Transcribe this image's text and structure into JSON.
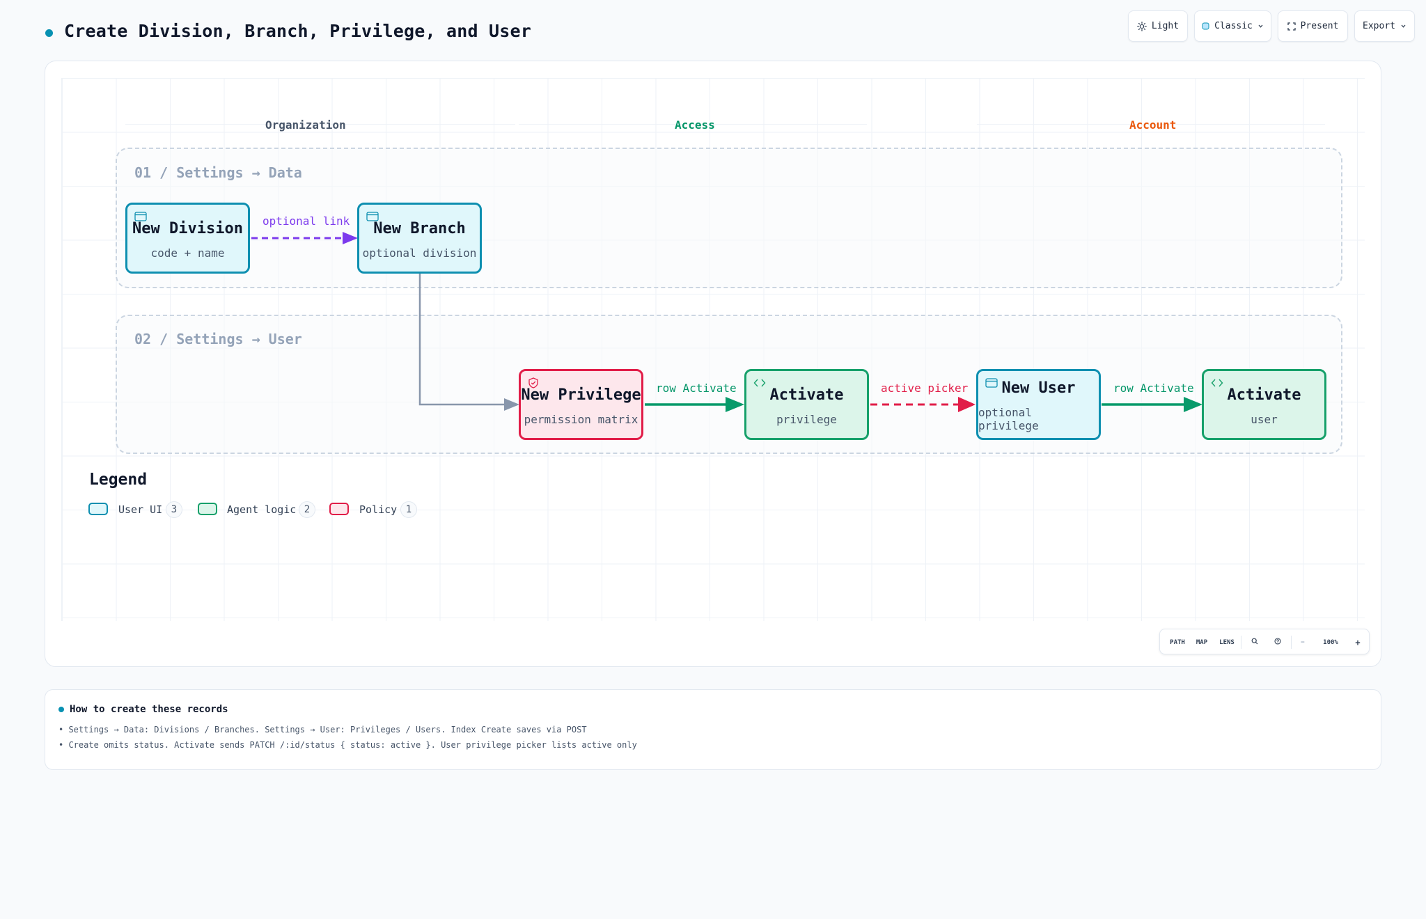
{
  "header": {
    "title": "Create Division, Branch, Privilege, and User",
    "buttons": {
      "theme": "Light",
      "style": "Classic",
      "present": "Present",
      "export": "Export"
    }
  },
  "colors": {
    "accent": "#0891b2",
    "ui": "#0e8fb0",
    "logic": "#16a06a",
    "policy": "#e11d48",
    "optional": "#7c3aed"
  },
  "lanes": [
    {
      "label": "Organization",
      "color": "#475569"
    },
    {
      "label": "Access",
      "color": "#059669"
    },
    {
      "label": "Account",
      "color": "#ea580c"
    }
  ],
  "groups": [
    {
      "label": "01 / Settings → Data"
    },
    {
      "label": "02 / Settings → User"
    }
  ],
  "nodes": {
    "new_division": {
      "title": "New Division",
      "sub": "code + name",
      "kind": "ui",
      "icon": "window-icon"
    },
    "new_branch": {
      "title": "New Branch",
      "sub": "optional division",
      "kind": "ui",
      "icon": "window-icon"
    },
    "new_privilege": {
      "title": "New Privilege",
      "sub": "permission matrix",
      "kind": "policy",
      "icon": "shield-icon"
    },
    "activate_privilege": {
      "title": "Activate",
      "sub": "privilege",
      "kind": "logic",
      "icon": "code-icon"
    },
    "new_user": {
      "title": "New User",
      "sub": "optional privilege",
      "kind": "ui",
      "icon": "window-icon"
    },
    "activate_user": {
      "title": "Activate",
      "sub": "user",
      "kind": "logic",
      "icon": "code-icon"
    }
  },
  "edges": {
    "division_to_branch": "optional link",
    "privilege_to_activate": "row Activate",
    "activate_to_user": "active picker",
    "user_to_activate": "row Activate"
  },
  "legend": {
    "title": "Legend",
    "items": [
      {
        "label": "User UI",
        "count": "3"
      },
      {
        "label": "Agent logic",
        "count": "2"
      },
      {
        "label": "Policy",
        "count": "1"
      }
    ]
  },
  "zoom_bar": {
    "path": "PATH",
    "map": "MAP",
    "lens": "LENS",
    "zoom": "100%",
    "minus": "−",
    "plus": "+"
  },
  "notes": {
    "title": "How to create these records",
    "lines": [
      "• Settings → Data: Divisions / Branches. Settings → User: Privileges / Users. Index Create saves via POST",
      "• Create omits status. Activate sends PATCH /:id/status { status: active }. User privilege picker lists active only"
    ]
  }
}
